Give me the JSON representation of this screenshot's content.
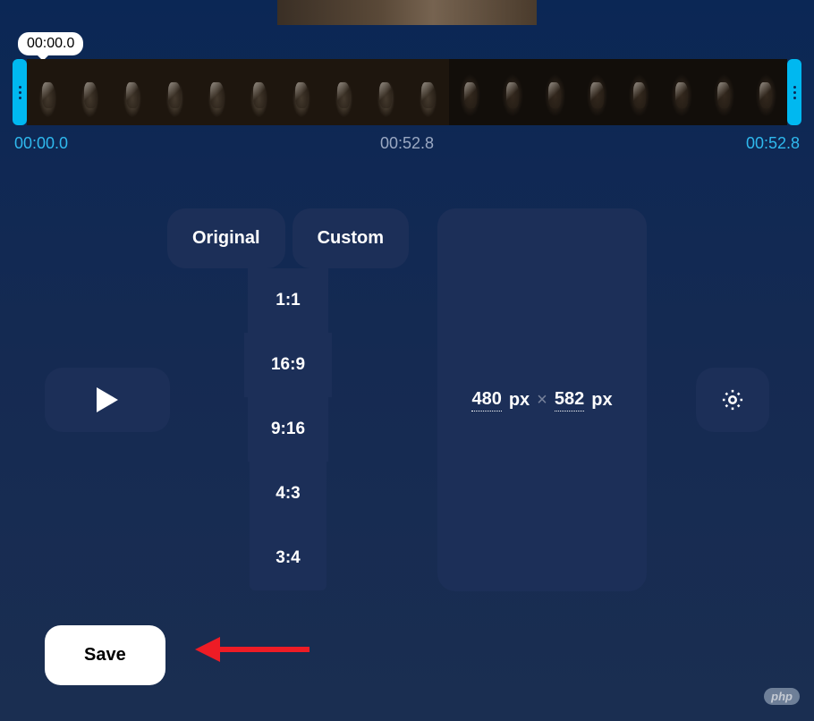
{
  "tooltip_time": "00:00.0",
  "timeline": {
    "start": "00:00.0",
    "mid": "00:52.8",
    "end": "00:52.8"
  },
  "tabs": {
    "original": "Original",
    "custom": "Custom"
  },
  "ratios": [
    "1:1",
    "16:9",
    "9:16",
    "4:3",
    "3:4"
  ],
  "dimensions": {
    "width": "480",
    "height": "582",
    "unit": "px",
    "separator": "×"
  },
  "save_label": "Save",
  "watermark": {
    "pill": "php",
    "text": ""
  }
}
